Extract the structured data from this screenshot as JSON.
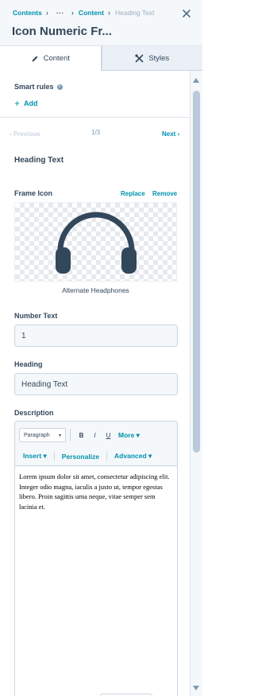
{
  "breadcrumb": {
    "items": [
      "Contents",
      "Content"
    ],
    "ellipsis": "···",
    "current": "Heading Text"
  },
  "title": "Icon Numeric Fr...",
  "tabs": [
    {
      "label": "Content",
      "icon": "pencil-icon",
      "active": true
    },
    {
      "label": "Styles",
      "icon": "tools-icon",
      "active": false
    }
  ],
  "smart_rules": {
    "label": "Smart rules",
    "add_label": "Add"
  },
  "pager": {
    "previous": "Previous",
    "count": "1/3",
    "next": "Next"
  },
  "section_title": "Heading Text",
  "frame_icon": {
    "label": "Frame Icon",
    "replace": "Replace",
    "remove": "Remove",
    "caption": "Alternate Headphones",
    "icon": "headphones-icon"
  },
  "number_text": {
    "label": "Number Text",
    "value": "1"
  },
  "heading": {
    "label": "Heading",
    "value": "Heading Text"
  },
  "description": {
    "label": "Description",
    "paragraph_select": "Paragraph",
    "format_buttons": [
      "B",
      "I",
      "U"
    ],
    "more": "More",
    "insert": "Insert",
    "personalize": "Personalize",
    "advanced": "Advanced",
    "body": "Lorem ipsum dolor sit amet, consectetur adipiscing elit. Integer odio magna, iaculis a justo ut, tempor egestas libero. Proin sagittis urna neque, vitae semper sem lacinia et."
  },
  "colors": {
    "accent": "#0091ae",
    "text": "#33475b",
    "border": "#cbd6e2",
    "icon": "#33475b"
  }
}
